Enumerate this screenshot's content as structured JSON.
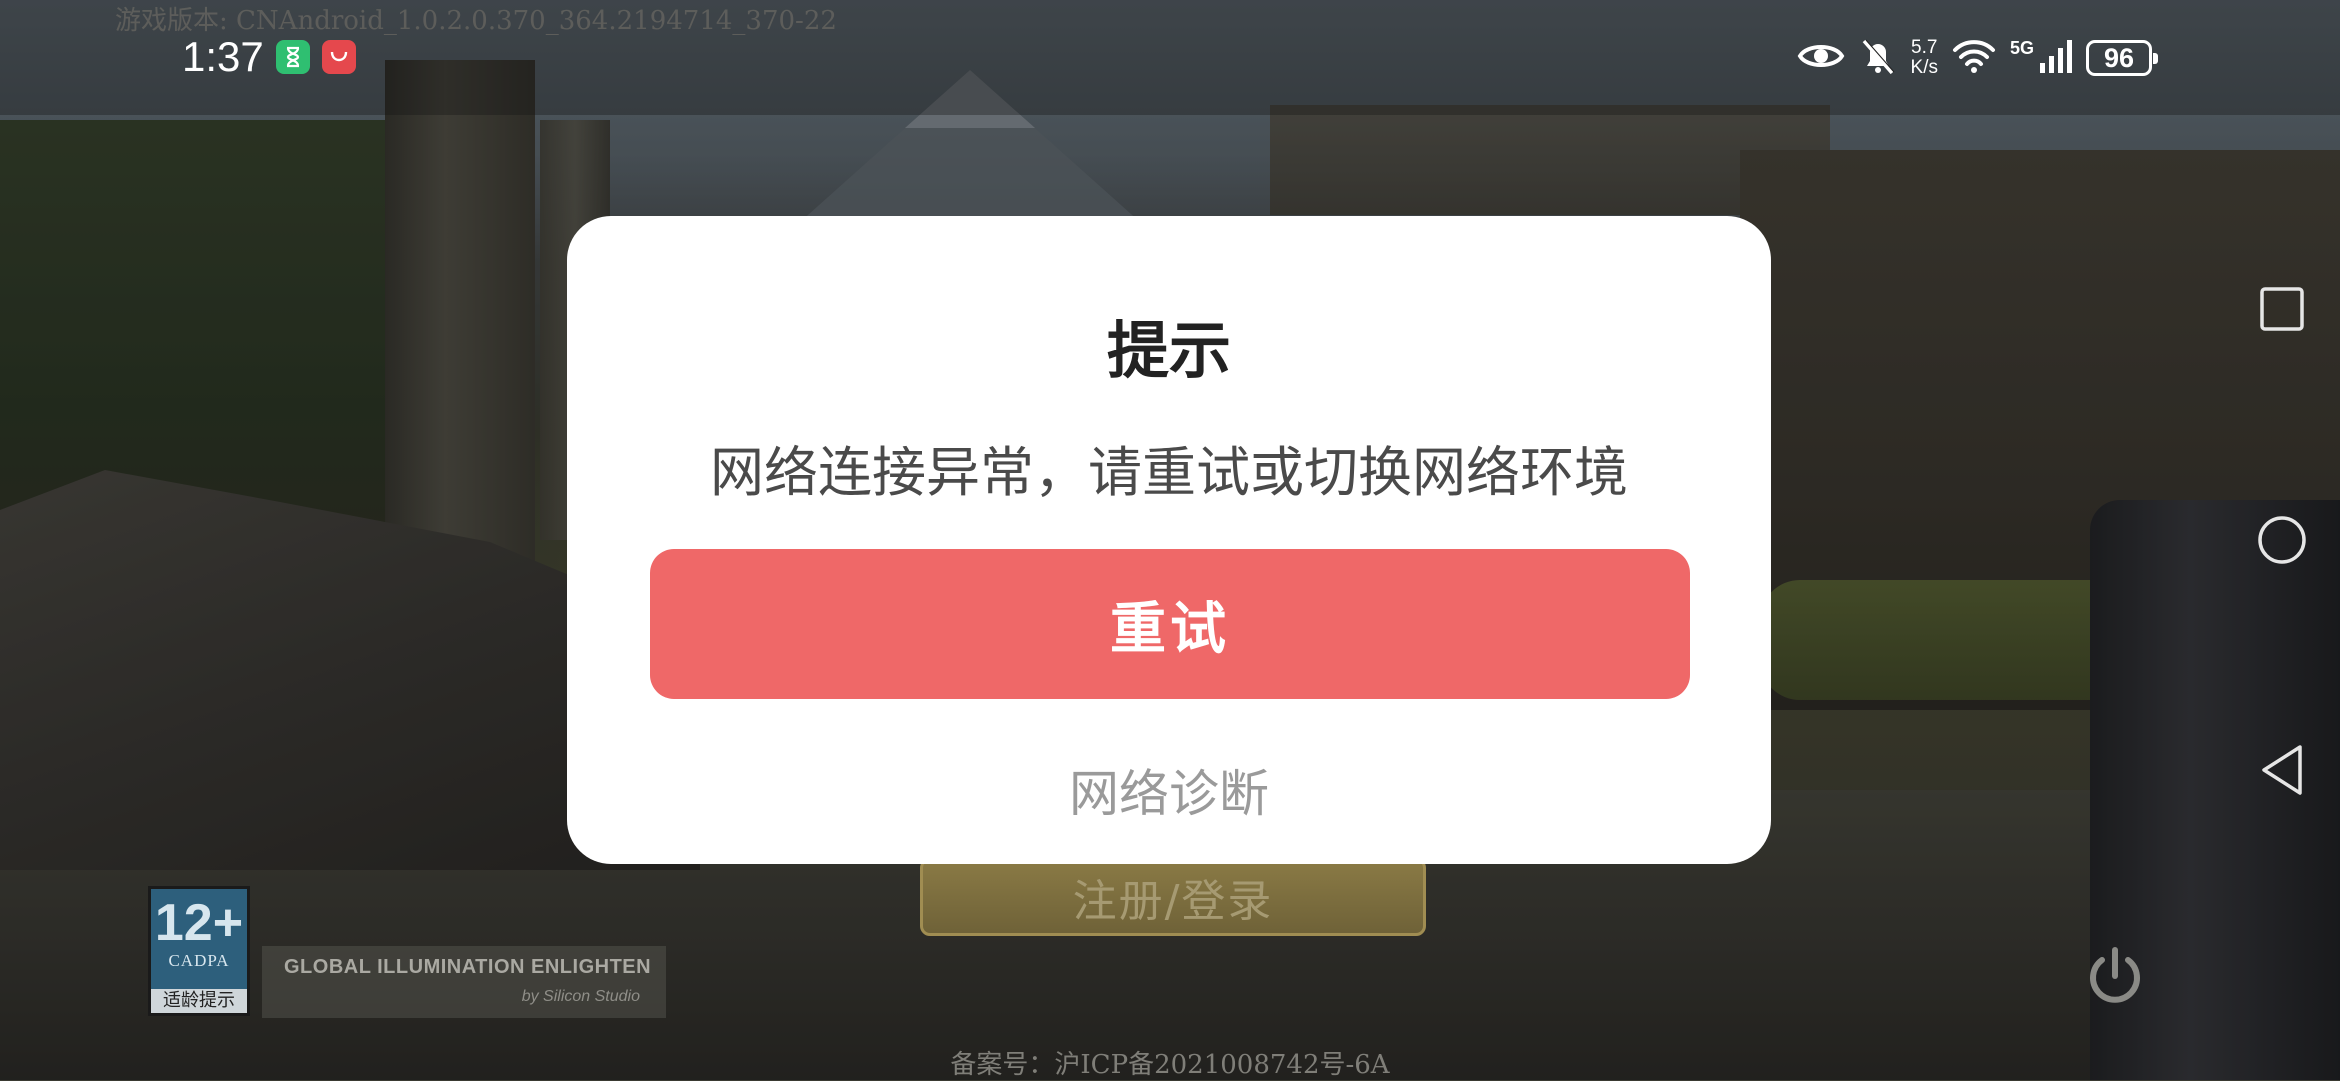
{
  "game": {
    "version_text": "游戏版本: CNAndroid_1.0.2.0.370_364.2194714_370-22",
    "login_button": "注册/登录",
    "age_rating": {
      "number": "12+",
      "org": "CADPA",
      "tip": "适龄提示"
    },
    "engine_credit": {
      "title": "GLOBAL ILLUMINATION ENLIGHTEN",
      "by": "by Silicon Studio"
    },
    "icp": "备案号：沪ICP备2021008742号-6A"
  },
  "status_bar": {
    "time": "1:37",
    "net_speed_value": "5.7",
    "net_speed_unit": "K/s",
    "network_type": "5G",
    "battery": "96",
    "icons": [
      "eye-icon",
      "notifications-off-icon",
      "wifi-icon",
      "signal-icon"
    ]
  },
  "dialog": {
    "title": "提示",
    "message": "网络连接异常，请重试或切换网络环境",
    "retry_label": "重试",
    "diagnose_label": "网络诊断"
  },
  "colors": {
    "retry_button": "#ef6868",
    "dialog_bg": "#ffffff"
  }
}
